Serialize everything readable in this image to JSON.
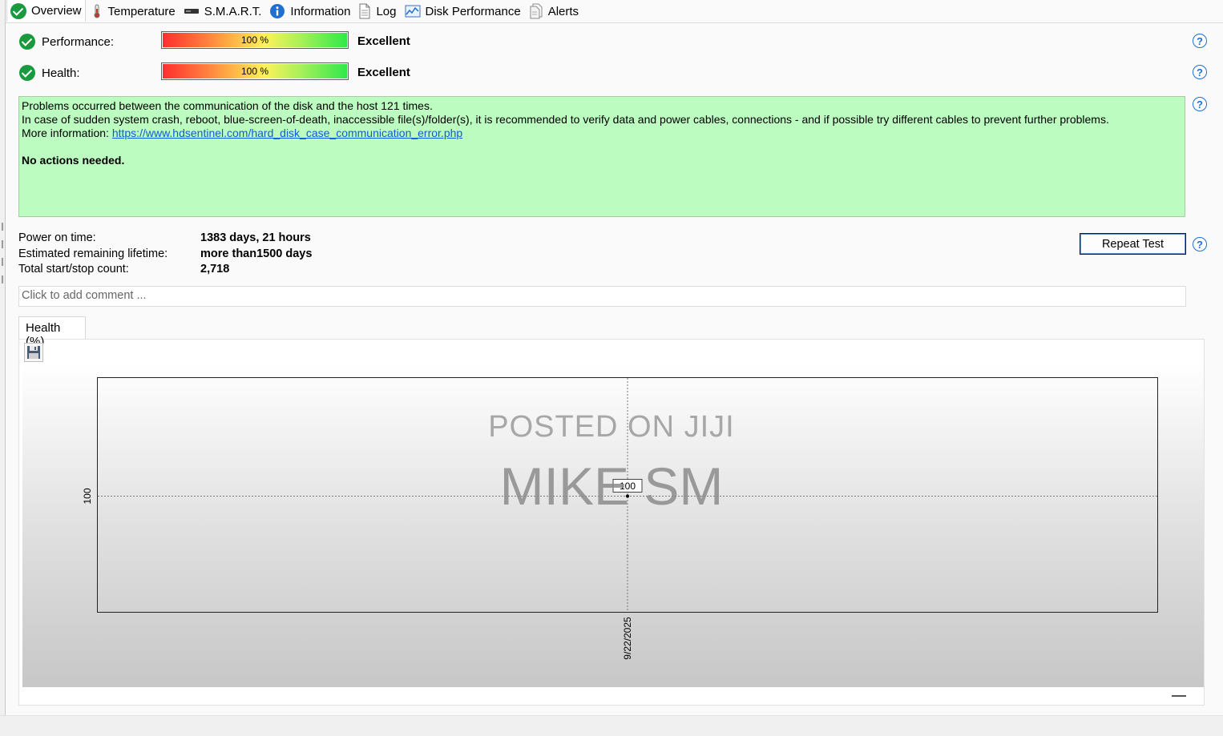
{
  "tabs": [
    {
      "label": "Overview",
      "icon": "check-circle-icon",
      "active": true
    },
    {
      "label": "Temperature",
      "icon": "thermometer-icon"
    },
    {
      "label": "S.M.A.R.T.",
      "icon": "drive-icon"
    },
    {
      "label": "Information",
      "icon": "info-icon"
    },
    {
      "label": "Log",
      "icon": "document-icon"
    },
    {
      "label": "Disk Performance",
      "icon": "performance-chart-icon"
    },
    {
      "label": "Alerts",
      "icon": "alerts-icon"
    }
  ],
  "performance": {
    "label": "Performance:",
    "percent_text": "100 %",
    "value": 100,
    "rating": "Excellent"
  },
  "health": {
    "label": "Health:",
    "percent_text": "100 %",
    "value": 100,
    "rating": "Excellent"
  },
  "message": {
    "line1": "Problems occurred between the communication of the disk and the host 121 times.",
    "line2": "In case of sudden system crash, reboot, blue-screen-of-death, inaccessible file(s)/folder(s), it is recommended to verify data and power cables, connections - and if possible try different cables to prevent further problems.",
    "more_prefix": "More information: ",
    "link": "https://www.hdsentinel.com/hard_disk_case_communication_error.php",
    "action": "No actions needed."
  },
  "stats": {
    "power_on_label": "Power on time:",
    "power_on_value": "1383 days, 21 hours",
    "lifetime_label": "Estimated remaining lifetime:",
    "lifetime_value": "more than1500 days",
    "startstop_label": "Total start/stop count:",
    "startstop_value": "2,718"
  },
  "repeat_test_label": "Repeat Test",
  "comment_placeholder": "Click to add comment ...",
  "chart_tab_label": "Health (%)",
  "watermark": {
    "line1": "POSTED ON JIJI",
    "line2": "MIKE SM"
  },
  "colors": {
    "message_bg": "#bdfcc0",
    "link": "#0b5cd6",
    "check": "#1a9a3e",
    "help": "#1f6fd0"
  },
  "chart_data": {
    "type": "line",
    "x": [
      "9/22/2025"
    ],
    "series": [
      {
        "values": [
          100
        ]
      }
    ],
    "point_label": "100",
    "y_tick_labels": [
      "100"
    ],
    "x_tick_labels": [
      "9/22/2025"
    ],
    "grid": "dotted crosshair at data point"
  }
}
